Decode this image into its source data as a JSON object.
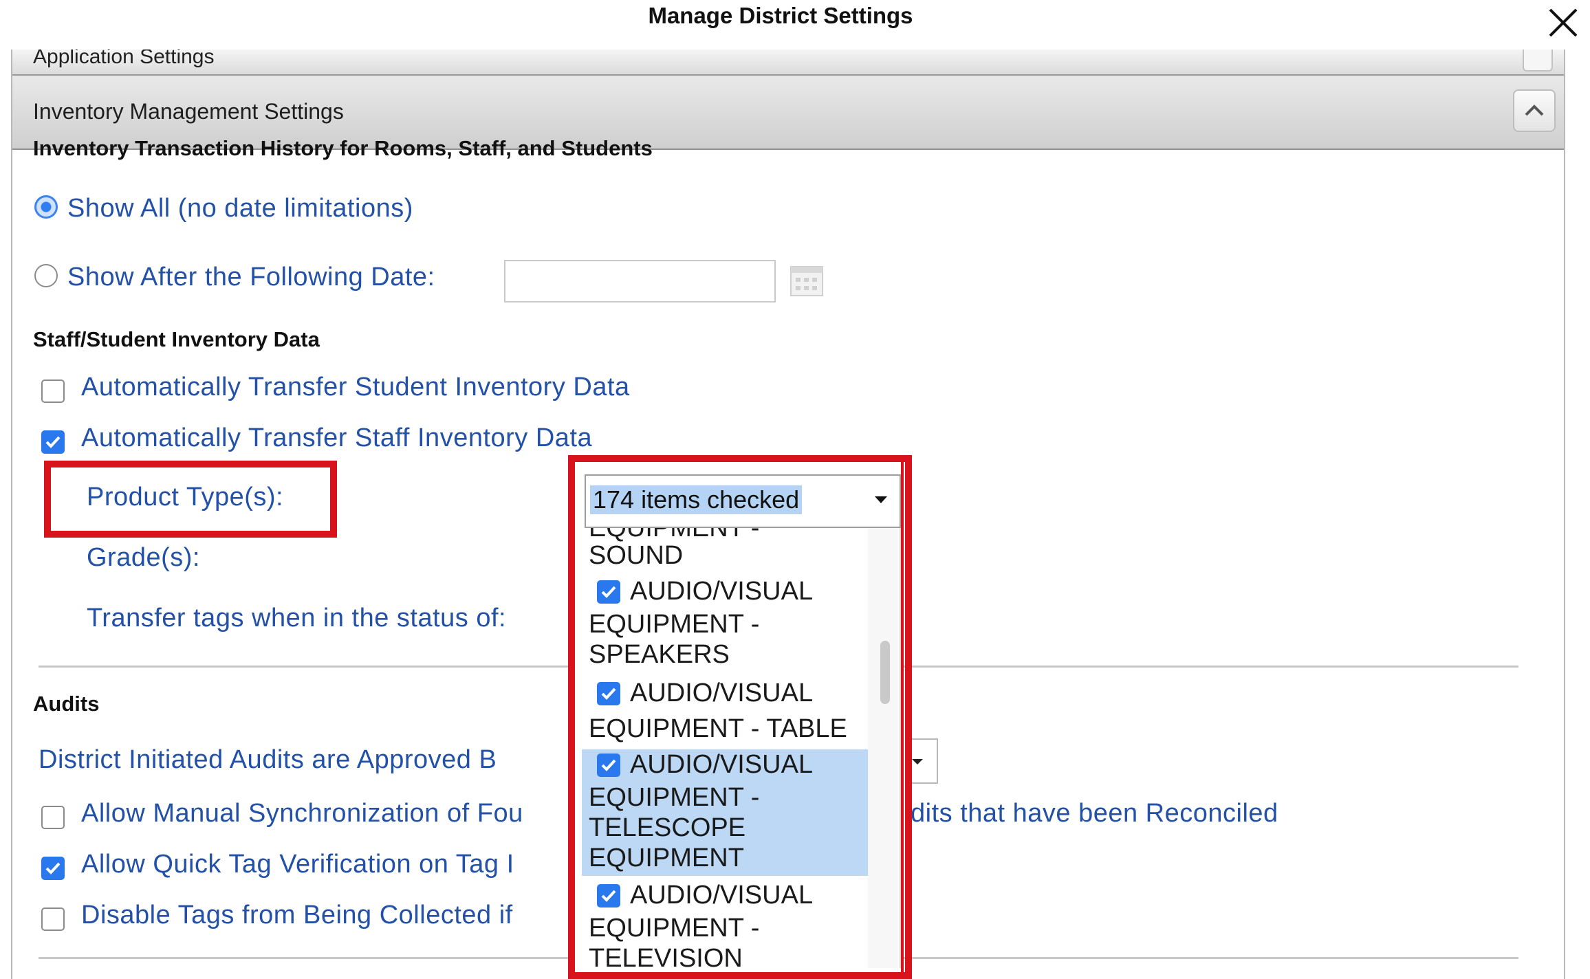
{
  "dialog": {
    "title": "Manage District Settings",
    "close_icon": "close-icon"
  },
  "collapsed_section": {
    "label": "Application Settings"
  },
  "section": {
    "title": "Inventory Management Settings",
    "toggle_icon": "chevron-up-icon"
  },
  "history": {
    "heading": "Inventory Transaction History for Rooms, Staff, and Students",
    "show_all": {
      "label": "Show All (no date limitations)",
      "selected": true
    },
    "show_after": {
      "label": "Show After the Following Date:",
      "selected": false,
      "date_value": ""
    },
    "calendar_icon": "calendar-icon"
  },
  "transfer": {
    "heading": "Staff/Student Inventory Data",
    "student_option": {
      "label": "Automatically Transfer Student Inventory Data",
      "checked": false
    },
    "staff_option": {
      "label": "Automatically Transfer Staff Inventory Data",
      "checked": true
    },
    "product_types_label": "Product Type(s):",
    "grades_label": "Grade(s):",
    "status_label": "Transfer tags when in the status of:"
  },
  "product_select": {
    "summary": "174 items checked",
    "arrow_icon": "caret-down-icon",
    "partial_item": {
      "top_line": "EQUIPMENT -",
      "bottom_line": "SOUND"
    },
    "items": [
      {
        "lines": [
          "AUDIO/VISUAL",
          "EQUIPMENT -",
          "SPEAKERS"
        ],
        "checked": true,
        "highlighted": false
      },
      {
        "lines": [
          "AUDIO/VISUAL",
          "EQUIPMENT - TABLE"
        ],
        "checked": true,
        "highlighted": false
      },
      {
        "lines": [
          "AUDIO/VISUAL",
          "EQUIPMENT -",
          "TELESCOPE",
          "EQUIPMENT"
        ],
        "checked": true,
        "highlighted": true
      },
      {
        "lines": [
          "AUDIO/VISUAL",
          "EQUIPMENT -",
          "TELEVISION"
        ],
        "checked": true,
        "highlighted": false
      }
    ]
  },
  "audits": {
    "heading": "Audits",
    "approved_by_label": "District Initiated Audits are Approved B",
    "manual_sync": {
      "label_start": "Allow Manual Synchronization of Fou",
      "label_end": "dits that have been Reconciled",
      "checked": false
    },
    "quick_verify": {
      "label": "Allow Quick Tag Verification on Tag I",
      "checked": true
    },
    "disable_tags": {
      "label": "Disable Tags from Being Collected if",
      "checked": false
    }
  },
  "colors": {
    "link_blue": "#2351a8",
    "highlight_red": "#d8131c",
    "checkbox_blue": "#2a78ee",
    "selection_blue": "#bcd8f4"
  }
}
